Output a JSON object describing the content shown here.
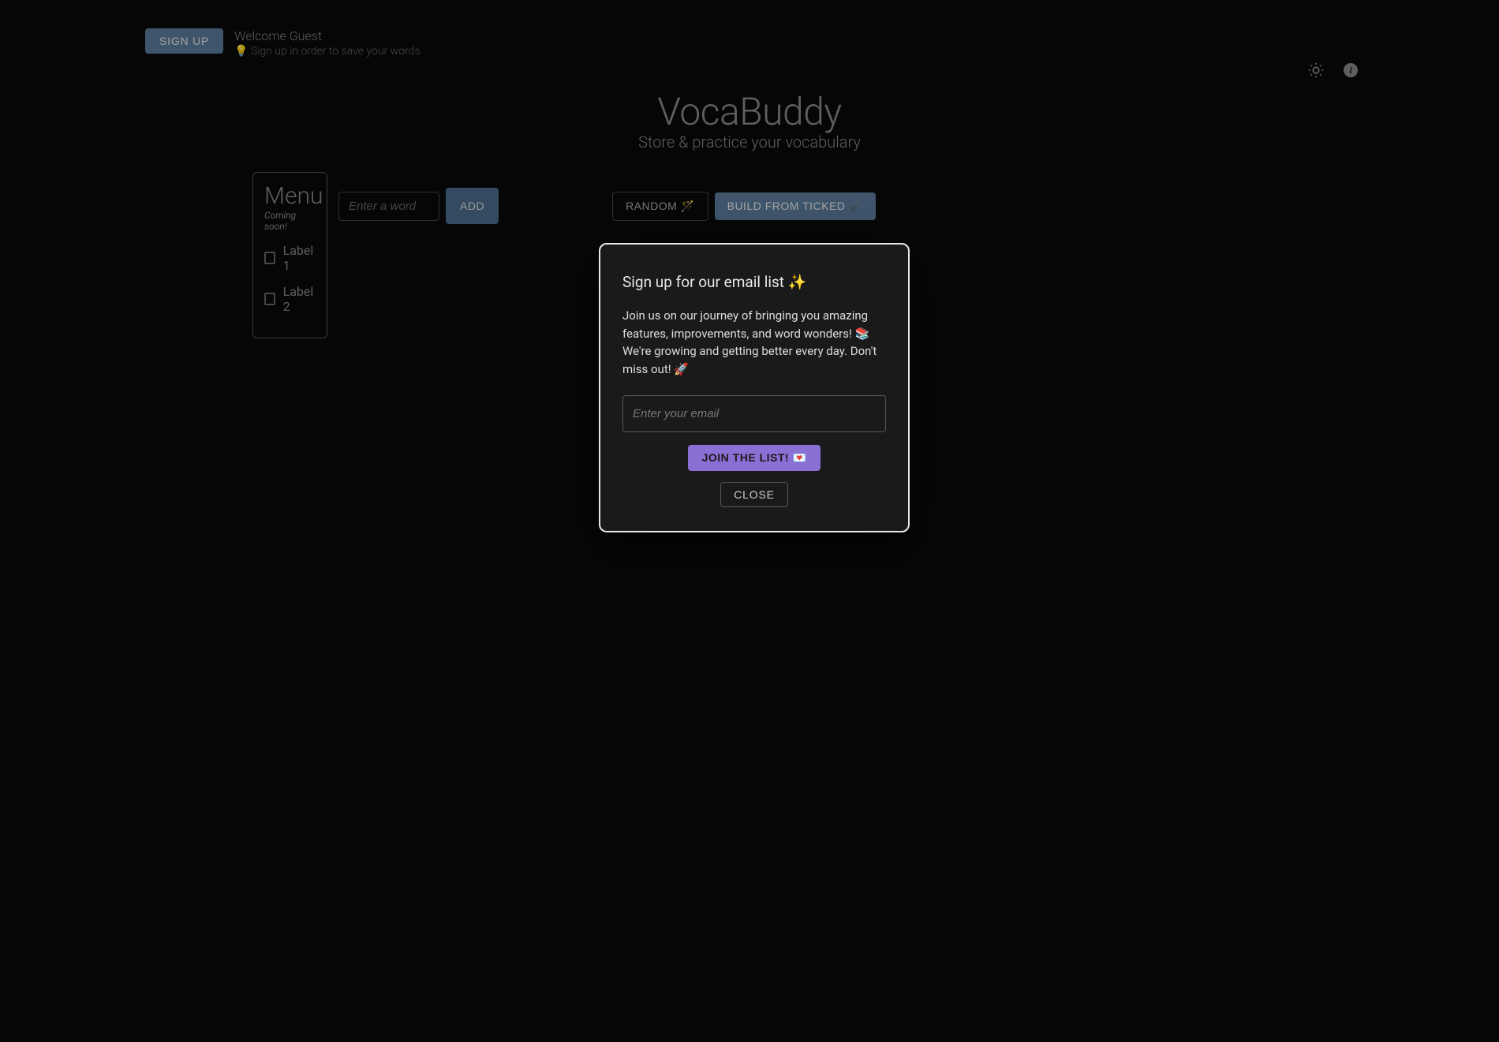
{
  "header": {
    "signup_label": "SIGN UP",
    "welcome_text": "Welcome Guest",
    "hint_text": "💡 Sign up in order to save your words"
  },
  "title": {
    "main": "VocaBuddy",
    "subtitle": "Store & practice your vocabulary"
  },
  "menu": {
    "title": "Menu",
    "subtitle": "Coming soon!",
    "items": [
      {
        "label": "Label 1"
      },
      {
        "label": "Label 2"
      }
    ]
  },
  "controls": {
    "word_placeholder": "Enter a word",
    "add_label": "ADD",
    "random_label": "RANDOM 🪄",
    "build_label": "BUILD FROM TICKED ✔️"
  },
  "modal": {
    "title": "Sign up for our email list ✨",
    "body": "Join us on our journey of bringing you amazing features, improvements, and word wonders! 📚 We're growing and getting better every day. Don't miss out! 🚀",
    "email_placeholder": "Enter your email",
    "join_label": "JOIN THE LIST! 💌",
    "close_label": "CLOSE"
  }
}
